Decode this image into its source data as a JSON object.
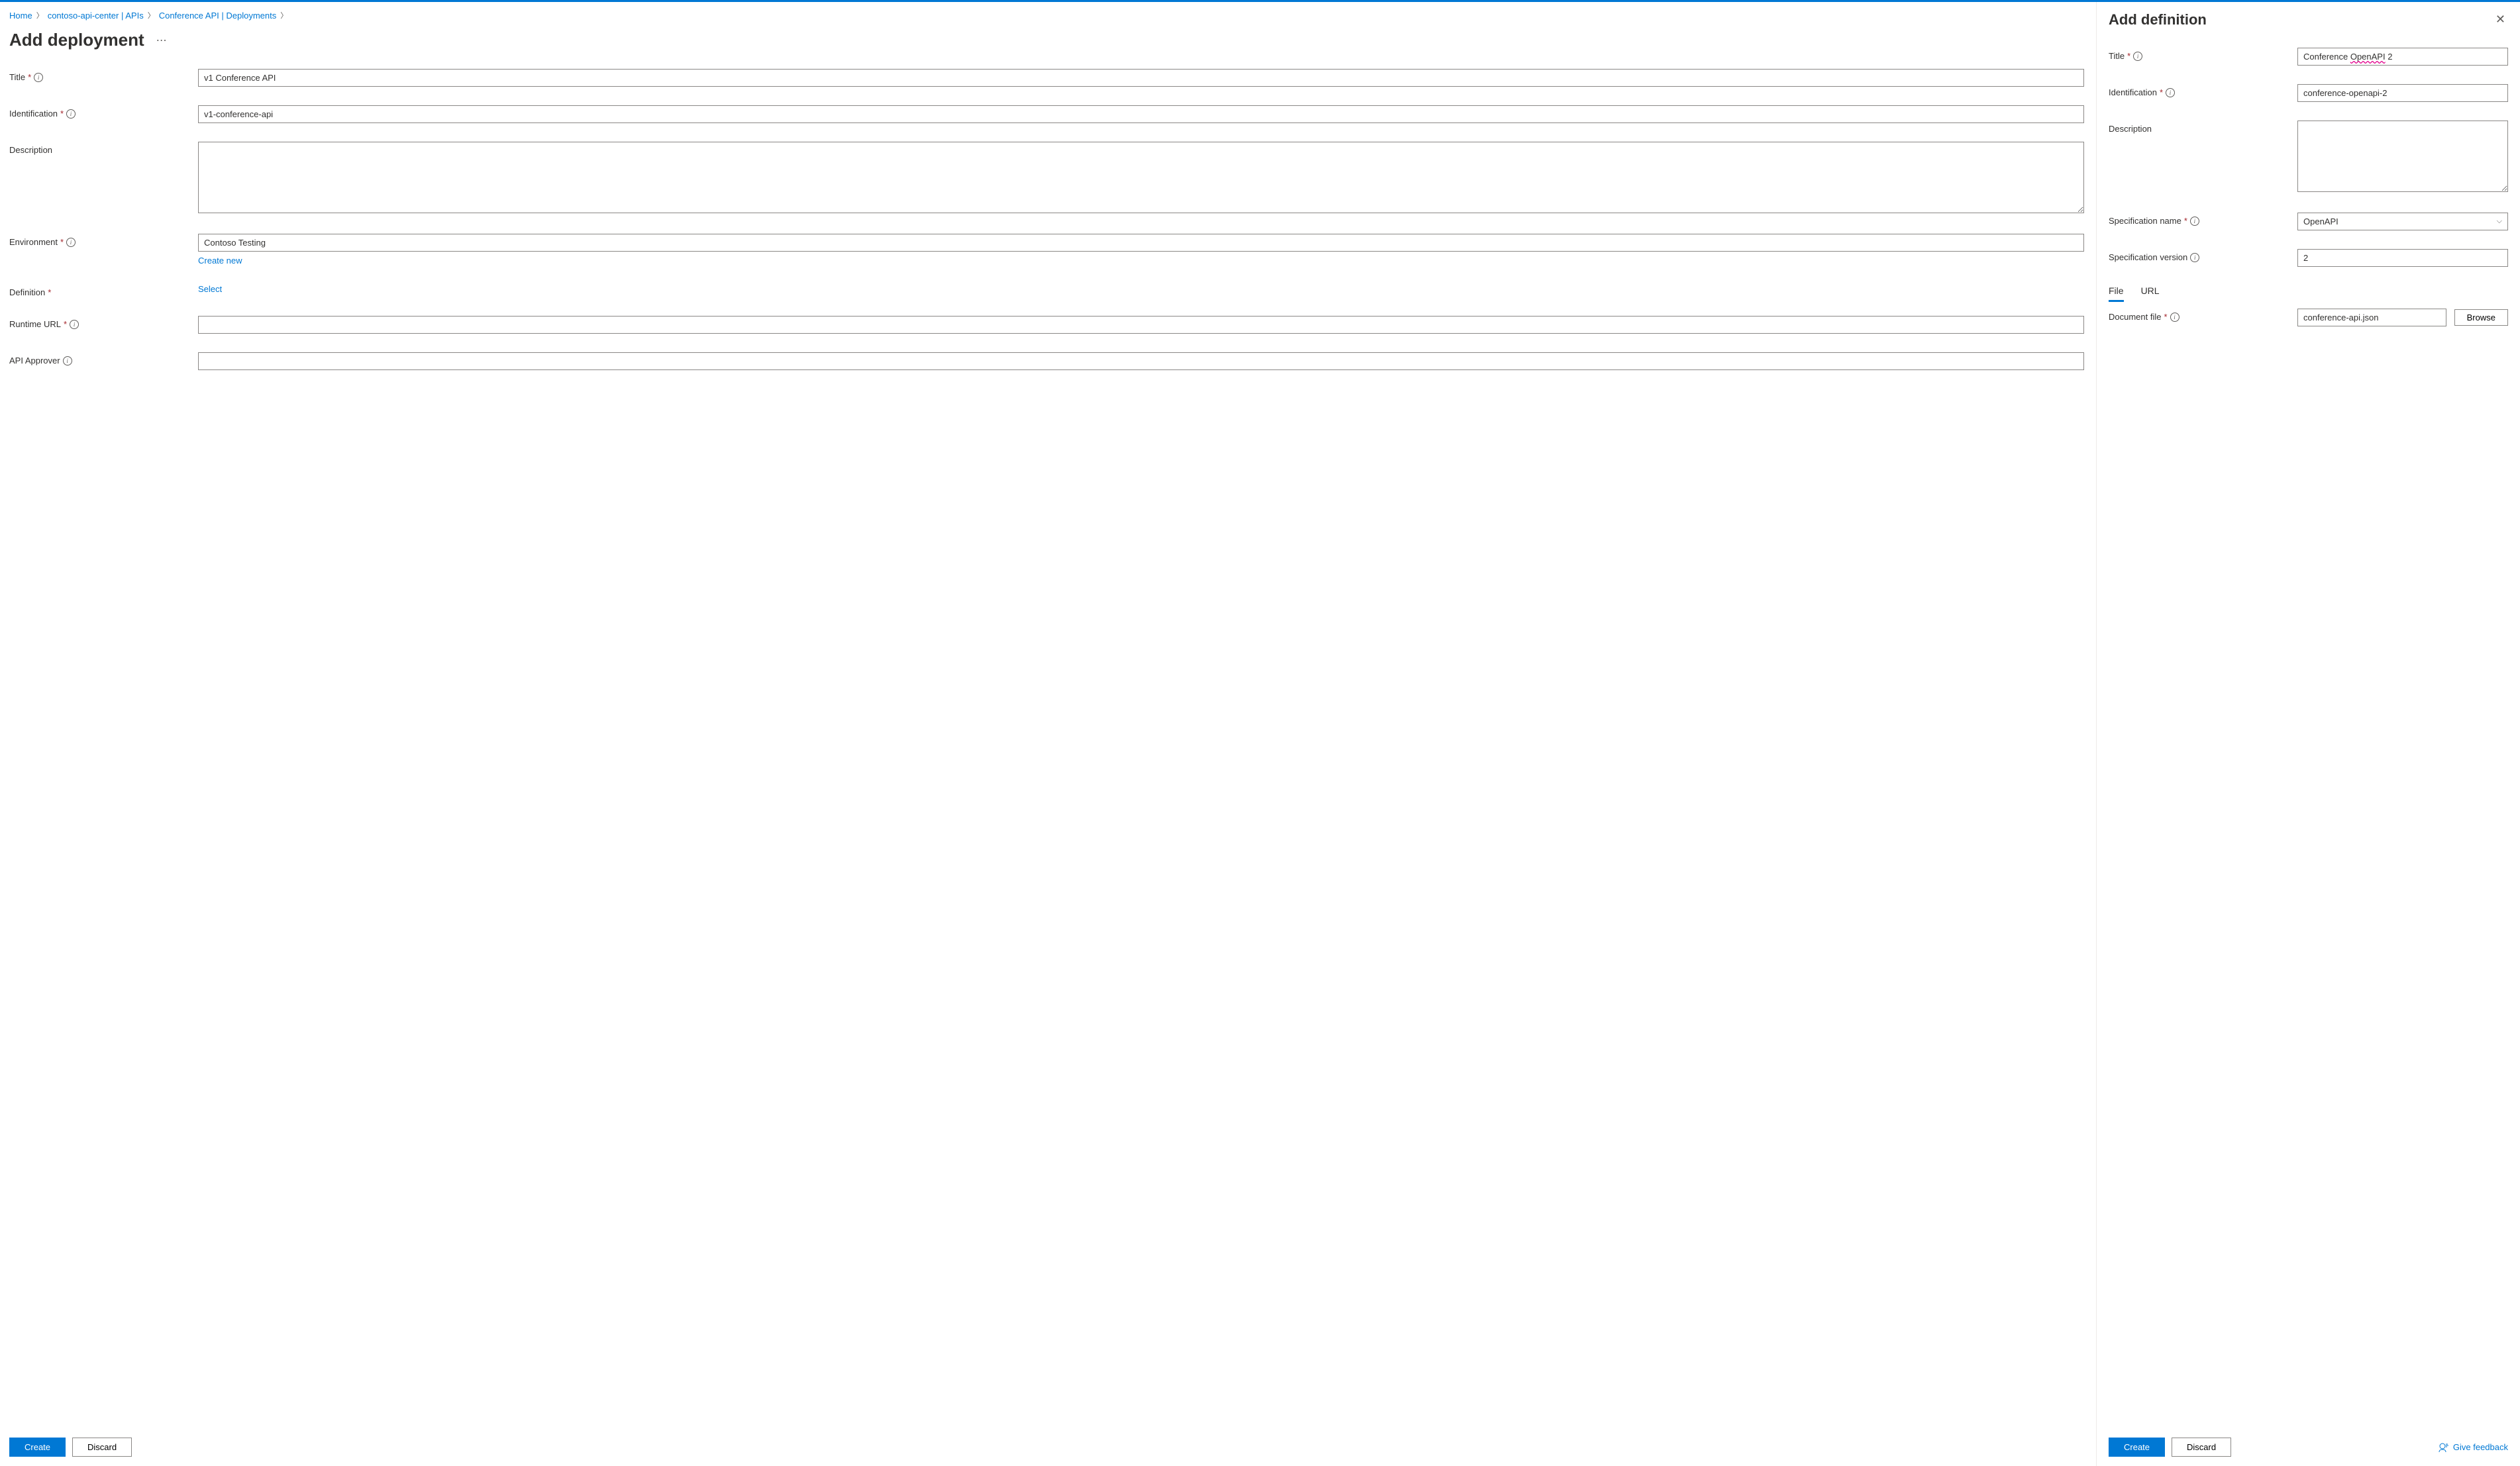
{
  "breadcrumb": {
    "items": [
      "Home",
      "contoso-api-center | APIs",
      "Conference API | Deployments"
    ]
  },
  "page": {
    "title": "Add deployment"
  },
  "deployment_form": {
    "title_label": "Title",
    "title_value": "v1 Conference API",
    "identification_label": "Identification",
    "identification_value": "v1-conference-api",
    "description_label": "Description",
    "description_value": "",
    "environment_label": "Environment",
    "environment_value": "Contoso Testing",
    "environment_create_new": "Create new",
    "definition_label": "Definition",
    "definition_select": "Select",
    "runtime_url_label": "Runtime URL",
    "runtime_url_value": "",
    "api_approver_label": "API Approver",
    "api_approver_value": ""
  },
  "panel": {
    "title": "Add definition"
  },
  "definition_form": {
    "title_label": "Title",
    "title_value_plain": "Conference OpenAPI 2",
    "identification_label": "Identification",
    "identification_value": "conference-openapi-2",
    "description_label": "Description",
    "description_value": "",
    "spec_name_label": "Specification name",
    "spec_name_value": "OpenAPI",
    "spec_version_label": "Specification version",
    "spec_version_value": "2",
    "tabs": {
      "file": "File",
      "url": "URL"
    },
    "doc_file_label": "Document file",
    "doc_file_value": "conference-api.json",
    "browse": "Browse"
  },
  "buttons": {
    "create": "Create",
    "discard": "Discard",
    "give_feedback": "Give feedback"
  }
}
